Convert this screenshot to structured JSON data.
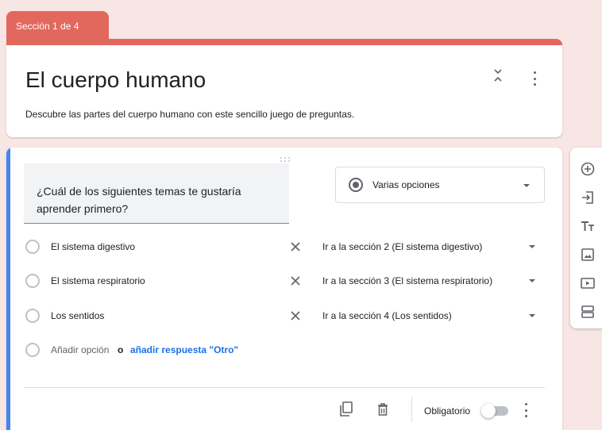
{
  "section_tab": {
    "label": "Sección 1 de 4"
  },
  "form_header": {
    "title": "El cuerpo humano",
    "description": "Descubre las partes del cuerpo humano con este sencillo juego de preguntas."
  },
  "question": {
    "text": "¿Cuál de los siguientes temas te gustaría aprender primero?",
    "type_label": "Varias opciones",
    "options": [
      {
        "label": "El sistema digestivo",
        "goto": "Ir a la sección 2 (El sistema digestivo)"
      },
      {
        "label": "El sistema respiratorio",
        "goto": "Ir a la sección 3 (El sistema respiratorio)"
      },
      {
        "label": "Los sentidos",
        "goto": "Ir a la sección 4 (Los sentidos)"
      }
    ],
    "add_option": "Añadir opción",
    "or_text": "o",
    "add_other": "añadir respuesta \"Otro\"",
    "required_label": "Obligatorio",
    "required": false
  },
  "side_toolbar": {
    "tools": [
      "add-question-icon",
      "import-questions-icon",
      "add-title-icon",
      "add-image-icon",
      "add-video-icon",
      "add-section-icon"
    ]
  },
  "colors": {
    "background": "#f8e6e4",
    "theme": "#e2685d",
    "accent_blue": "#4285f4",
    "link_blue": "#1a73e8"
  }
}
